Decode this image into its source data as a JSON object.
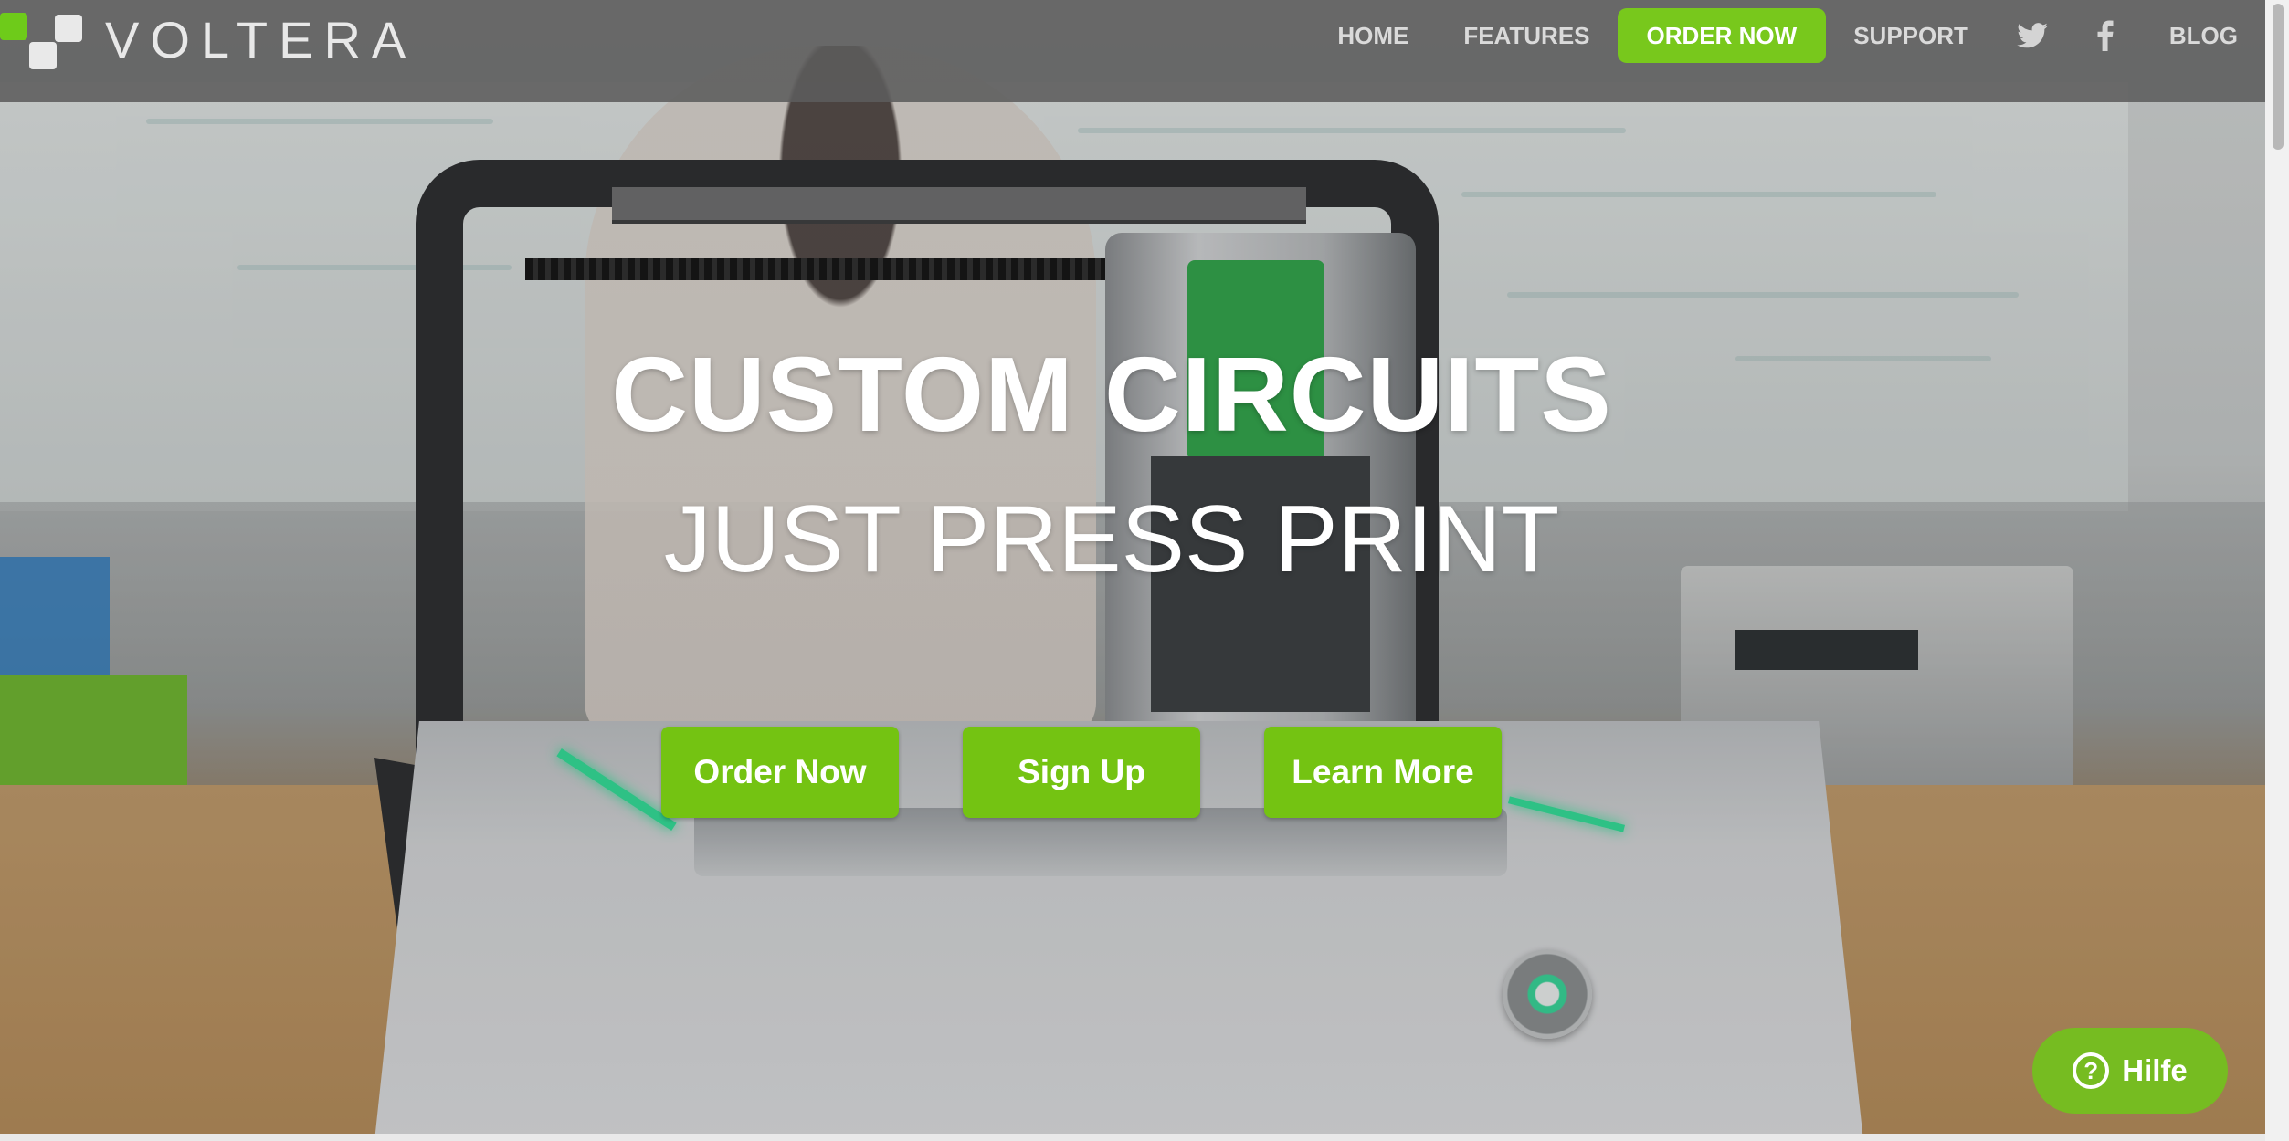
{
  "brand": {
    "name": "VOLTERA",
    "accent": "#78c81c"
  },
  "nav": {
    "home": "HOME",
    "features": "FEATURES",
    "order_now": "ORDER NOW",
    "support": "SUPPORT",
    "twitter_icon": "twitter-icon",
    "facebook_icon": "facebook-icon",
    "blog": "BLOG"
  },
  "hero": {
    "headline": "CUSTOM CIRCUITS",
    "subheadline": "JUST PRESS PRINT",
    "buttons": [
      "Order Now",
      "Sign Up",
      "Learn More"
    ]
  },
  "help": {
    "label": "Hilfe",
    "icon": "question-icon"
  }
}
